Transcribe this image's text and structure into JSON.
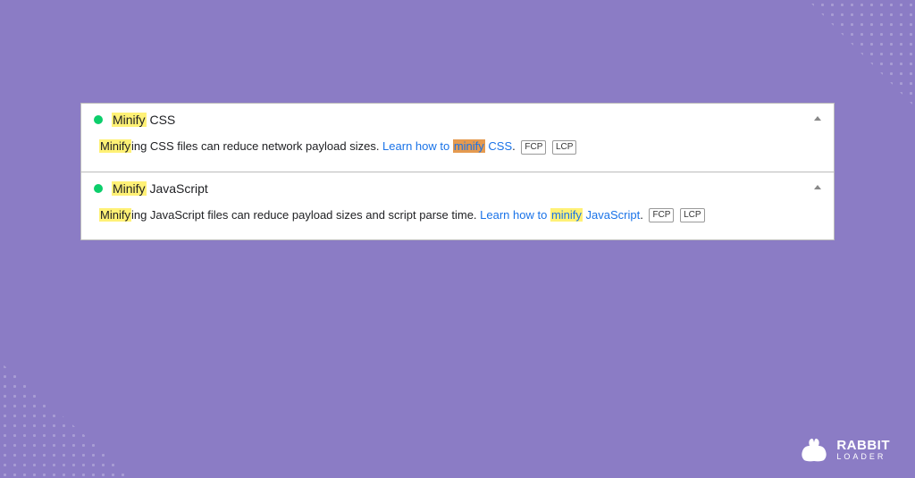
{
  "audits": [
    {
      "title_hl": "Minify",
      "title_rest": " CSS",
      "desc_hl": "Minify",
      "desc_rest": "ing CSS files can reduce network payload sizes. ",
      "link_pre": "Learn how to ",
      "link_hl": "minify",
      "link_hl_style": "orange",
      "link_post": " CSS",
      "link_punct": ".",
      "badges": [
        "FCP",
        "LCP"
      ]
    },
    {
      "title_hl": "Minify",
      "title_rest": " JavaScript",
      "desc_hl": "Minify",
      "desc_rest": "ing JavaScript files can reduce payload sizes and script parse time. ",
      "link_pre": "Learn how to ",
      "link_hl": "minify",
      "link_hl_style": "yellow",
      "link_post": " JavaScript",
      "link_punct": ".",
      "badges": [
        "FCP",
        "LCP"
      ]
    }
  ],
  "logo": {
    "name": "RABBIT",
    "sub": "LOADER"
  },
  "colors": {
    "accent": "#8b7cc5",
    "pass": "#0cce6b",
    "link": "#1a73e8"
  }
}
